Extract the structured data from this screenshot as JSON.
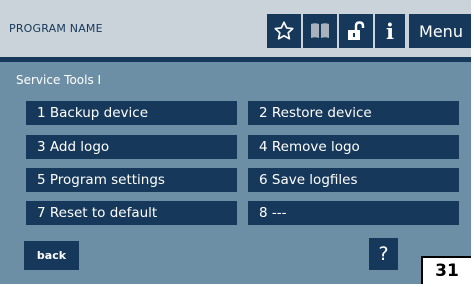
{
  "header": {
    "program_name": "PROGRAM NAME",
    "icons": [
      "star-icon",
      "book-icon",
      "unlock-icon",
      "info-icon"
    ],
    "info_glyph": "i",
    "menu_label": "Menu"
  },
  "section_title": "Service Tools I",
  "tools": [
    {
      "label": "1 Backup device"
    },
    {
      "label": "2 Restore device"
    },
    {
      "label": "3 Add logo"
    },
    {
      "label": "4 Remove logo"
    },
    {
      "label": "5 Program settings"
    },
    {
      "label": "6 Save logfiles"
    },
    {
      "label": "7 Reset to default"
    },
    {
      "label": "8 ---"
    }
  ],
  "back_label": "back",
  "help_label": "?",
  "page_number": "31",
  "colors": {
    "background": "#6d8fa6",
    "header_background": "#cbd3da",
    "button": "#16385a",
    "text_on_button": "#ffffff"
  }
}
